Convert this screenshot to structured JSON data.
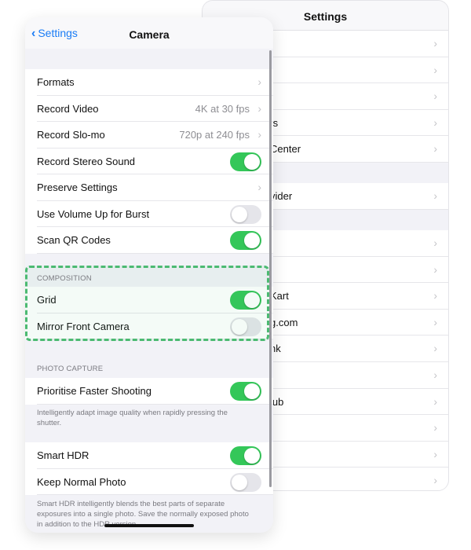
{
  "back_panel": {
    "title": "Settings",
    "rows": [
      "",
      "ı",
      "",
      "ts",
      "Center",
      "vider",
      "",
      "",
      "Kart",
      "g.com",
      "nk",
      "",
      "lub",
      "",
      "",
      ""
    ]
  },
  "front_panel": {
    "back_label": "Settings",
    "title": "Camera",
    "rows": [
      {
        "label": "Formats",
        "value": "",
        "chevron": true
      },
      {
        "label": "Record Video",
        "value": "4K at 30 fps",
        "chevron": true
      },
      {
        "label": "Record Slo-mo",
        "value": "720p at 240 fps",
        "chevron": true
      },
      {
        "label": "Record Stereo Sound",
        "toggle": true
      },
      {
        "label": "Preserve Settings",
        "value": "",
        "chevron": true
      },
      {
        "label": "Use Volume Up for Burst",
        "toggle": false
      },
      {
        "label": "Scan QR Codes",
        "toggle": true
      }
    ],
    "composition": {
      "header": "COMPOSITION",
      "rows": [
        {
          "label": "Grid",
          "toggle": true
        },
        {
          "label": "Mirror Front Camera",
          "toggle": false
        }
      ]
    },
    "photo_capture": {
      "header": "PHOTO CAPTURE",
      "rows": [
        {
          "label": "Prioritise Faster Shooting",
          "toggle": true
        }
      ],
      "note": "Intelligently adapt image quality when rapidly pressing the shutter."
    },
    "hdr": {
      "rows": [
        {
          "label": "Smart HDR",
          "toggle": true
        },
        {
          "label": "Keep Normal Photo",
          "toggle": false
        }
      ],
      "note": "Smart HDR intelligently blends the best parts of separate exposures into a single photo. Save the normally exposed photo in addition to the HDR version."
    }
  },
  "colors": {
    "accent": "#1a7cf5",
    "toggle_on": "#34c759",
    "highlight": "#4cba72"
  }
}
